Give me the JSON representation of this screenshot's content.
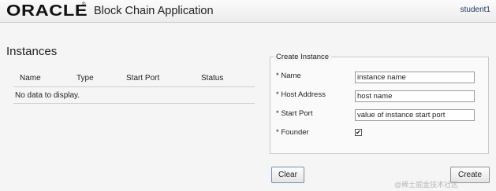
{
  "header": {
    "logo": "ORACLE",
    "logo_mark": "®",
    "app_title": "Block Chain Application",
    "user": "student1"
  },
  "instances": {
    "title": "Instances",
    "columns": [
      "Name",
      "Type",
      "Start Port",
      "Status"
    ],
    "empty_message": "No data to display."
  },
  "create_form": {
    "legend": "Create Instance",
    "name_label": "* Name",
    "name_placeholder": "instance name",
    "host_label": "* Host Address",
    "host_placeholder": "host name",
    "port_label": "* Start Port",
    "port_placeholder": "value of instance start port",
    "founder_label": "* Founder",
    "founder_checked": true,
    "check_glyph": "✔"
  },
  "buttons": {
    "clear": "Clear",
    "create": "Create"
  },
  "watermark": "@稀土掘金技术社区"
}
